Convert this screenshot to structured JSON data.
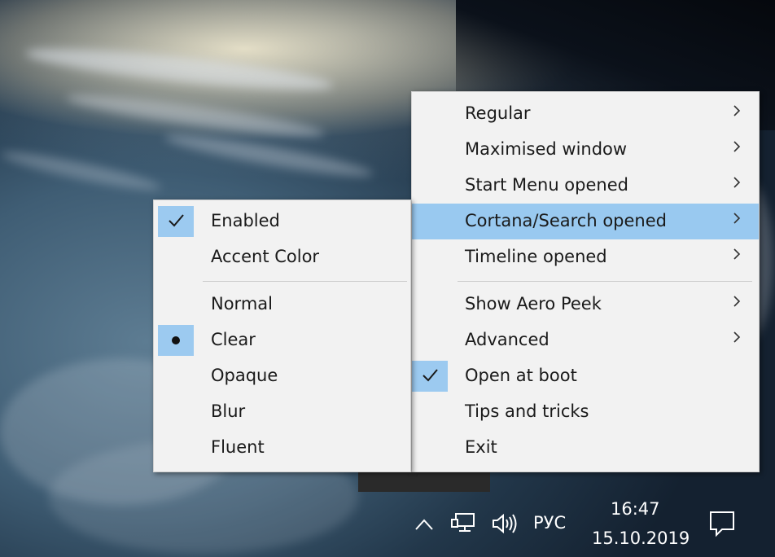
{
  "main_menu": {
    "items": [
      {
        "label": "Regular",
        "submenu": true
      },
      {
        "label": "Maximised window",
        "submenu": true
      },
      {
        "label": "Start Menu opened",
        "submenu": true
      },
      {
        "label": "Cortana/Search opened",
        "submenu": true,
        "highlighted": true
      },
      {
        "label": "Timeline opened",
        "submenu": true
      },
      {
        "label": "Show Aero Peek",
        "submenu": true
      },
      {
        "label": "Advanced",
        "submenu": true
      },
      {
        "label": "Open at boot",
        "checked": true
      },
      {
        "label": "Tips and tricks"
      },
      {
        "label": "Exit"
      }
    ]
  },
  "sub_menu": {
    "items": [
      {
        "label": "Enabled",
        "checked": true
      },
      {
        "label": "Accent Color"
      },
      {
        "label": "Normal"
      },
      {
        "label": "Clear",
        "selected": true
      },
      {
        "label": "Opaque"
      },
      {
        "label": "Blur"
      },
      {
        "label": "Fluent"
      }
    ]
  },
  "taskbar": {
    "language": "РУС",
    "time": "16:47",
    "date": "15.10.2019",
    "icons": [
      "chevron-up-icon",
      "network-icon",
      "volume-icon",
      "notification-icon"
    ]
  },
  "colors": {
    "menu_bg": "#f2f2f2",
    "highlight": "#99c9f0",
    "check_bg": "#9ccaf0"
  }
}
